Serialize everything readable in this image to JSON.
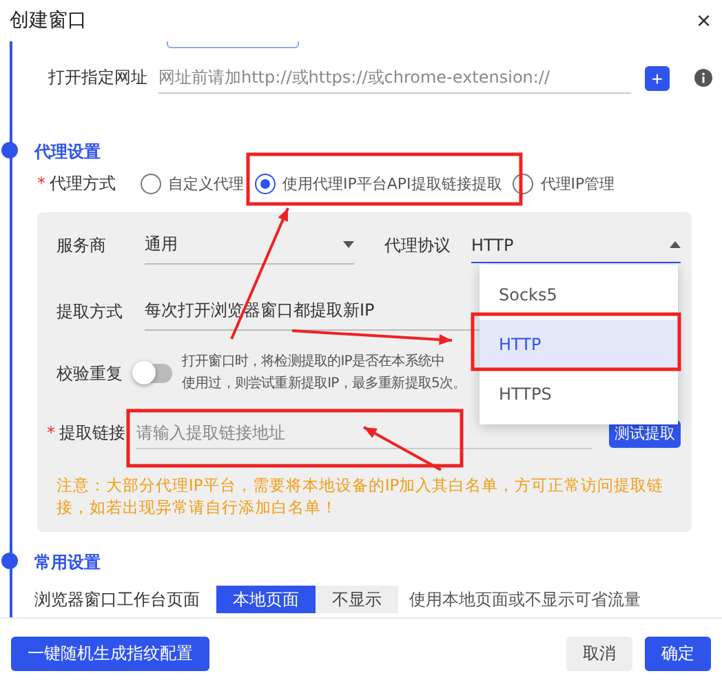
{
  "window": {
    "title": "创建窗口",
    "close": "×"
  },
  "url_row": {
    "label": "打开指定网址",
    "placeholder": "网址前请加http://或https://或chrome-extension://",
    "add": "+"
  },
  "proxy": {
    "title": "代理设置",
    "mode": {
      "label": "代理方式",
      "required_mark": "*",
      "options": [
        {
          "label": "自定义代理",
          "selected": false
        },
        {
          "label": "使用代理IP平台API提取链接提取",
          "selected": true
        },
        {
          "label": "代理IP管理",
          "selected": false
        }
      ]
    },
    "provider": {
      "label": "服务商",
      "value": "通用"
    },
    "protocol": {
      "label": "代理协议",
      "value": "HTTP",
      "expanded": true,
      "options": [
        {
          "label": "Socks5",
          "selected": false
        },
        {
          "label": "HTTP",
          "selected": true
        },
        {
          "label": "HTTPS",
          "selected": false
        }
      ]
    },
    "extract_method": {
      "label": "提取方式",
      "value": "每次打开浏览器窗口都提取新IP"
    },
    "dedupe": {
      "label": "校验重复",
      "on": false,
      "description": [
        "打开窗口时，将检测提取的IP是否在本系统中",
        "使用过，则尝试重新提取IP，最多重新提取5次。"
      ]
    },
    "link": {
      "label": "提取链接",
      "required_mark": "*",
      "placeholder": "请输入提取链接地址",
      "button": "测试提取"
    },
    "notice": "注意：大部分代理IP平台，需要将本地设备的IP加入其白名单，方可正常访问提取链接，如若出现异常请自行添加白名单！"
  },
  "general": {
    "title": "常用设置",
    "workbench": {
      "label": "浏览器窗口工作台页面",
      "options": [
        {
          "label": "本地页面",
          "selected": true
        },
        {
          "label": "不显示",
          "selected": false
        }
      ],
      "hint": "使用本地页面或不显示可省流量"
    }
  },
  "footer": {
    "random_button": "一键随机生成指纹配置",
    "cancel": "取消",
    "confirm": "确定"
  }
}
